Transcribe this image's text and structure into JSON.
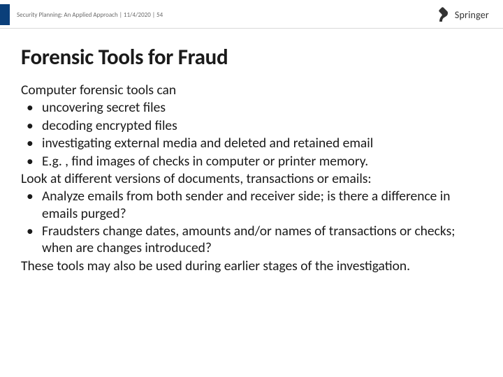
{
  "header": {
    "doc_title": "Security Planning: An Applied Approach",
    "date": "11/4/2020",
    "page": "54",
    "brand": "Springer"
  },
  "slide": {
    "title": "Forensic Tools for Fraud",
    "lead1": "Computer forensic tools can",
    "bullets1": [
      "uncovering secret files",
      "decoding encrypted files",
      "investigating external media and deleted and retained email",
      "E.g. , find images of checks in computer or printer memory."
    ],
    "lead2": "Look at different versions of documents, transactions or emails:",
    "bullets2": [
      "Analyze emails from both sender and receiver side; is there a difference in emails purged?",
      "Fraudsters change dates, amounts and/or names of transactions or checks; when are changes introduced?"
    ],
    "closing": "These tools may also be used during earlier stages of the investigation."
  }
}
